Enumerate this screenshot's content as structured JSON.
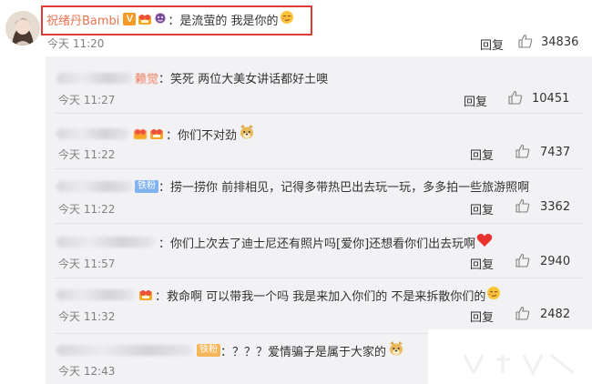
{
  "main_comment": {
    "username": "祝绪丹Bambi",
    "verified_mark": "V",
    "text": "：是流萤的 我是你的",
    "time": "今天 11:20",
    "reply_label": "回复",
    "likes": "34836"
  },
  "replies": [
    {
      "name_tail": "赖觉",
      "text": "：笑死  两位大美女讲话都好土噢",
      "time": "今天 11:27",
      "reply_label": "回复",
      "likes": "10451"
    },
    {
      "name_tail": "",
      "text": "：你们不对劲",
      "time": "今天 11:22",
      "reply_label": "回复",
      "likes": "7437"
    },
    {
      "name_tail": "铁粉",
      "text": "：捞一捞你 前排相见，记得多带热巴出去玩一玩，多多拍一些旅游照啊",
      "time": "今天 11:22",
      "reply_label": "回复",
      "likes": "3362"
    },
    {
      "name_tail": "",
      "text": "：你们上次去了迪士尼还有照片吗[爱你]还想看你们出去玩啊",
      "time": "今天 11:57",
      "reply_label": "回复",
      "likes": "2940"
    },
    {
      "name_tail": "",
      "text": "：救命啊 可以带我一个吗 我是来加入你们的 不是来拆散你们的",
      "time": "今天 11:32",
      "reply_label": "回复",
      "likes": "2482"
    },
    {
      "name_tail": "铁粉",
      "text": "：？？？爱情骗子是属于大家的",
      "time": "今天 12:43",
      "reply_label": "",
      "likes": ""
    }
  ],
  "icons": {
    "like": "thumb-up-icon",
    "devil": "devil-face-emoji",
    "smirk": "smirk-face-emoji",
    "doge": "doge-emoji",
    "heart": "heart-emoji"
  },
  "colors": {
    "username": "#eb7350",
    "highlight": "#e03b3b",
    "reply_bg": "#f2f2f5",
    "time": "#808080",
    "fan_badge": "#7fb3f0",
    "fan_badge_orange": "#f6b65a"
  }
}
